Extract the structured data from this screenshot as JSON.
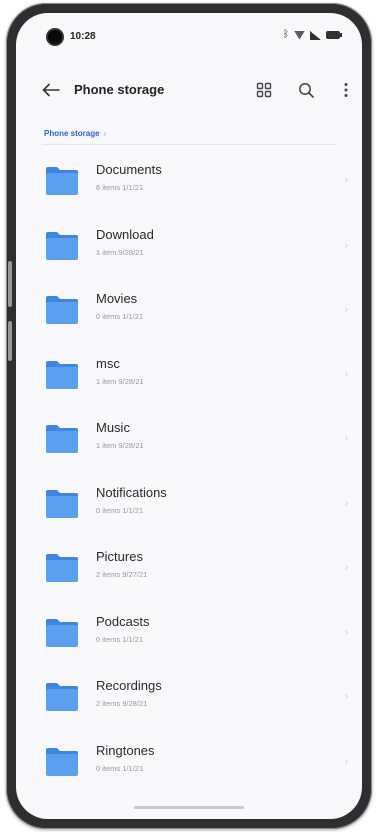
{
  "status_bar": {
    "time": "10:28"
  },
  "app_bar": {
    "title": "Phone storage"
  },
  "breadcrumb": {
    "items": [
      "Phone storage"
    ],
    "separator": "›"
  },
  "files": [
    {
      "name": "Documents",
      "meta": "6 items   1/1/21"
    },
    {
      "name": "Download",
      "meta": "1 item   9/28/21"
    },
    {
      "name": "Movies",
      "meta": "0 items   1/1/21"
    },
    {
      "name": "msc",
      "meta": "1 item   9/28/21"
    },
    {
      "name": "Music",
      "meta": "1 item   9/28/21"
    },
    {
      "name": "Notifications",
      "meta": "0 items   1/1/21"
    },
    {
      "name": "Pictures",
      "meta": "2 items   9/27/21"
    },
    {
      "name": "Podcasts",
      "meta": "0 items   1/1/21"
    },
    {
      "name": "Recordings",
      "meta": "2 items   9/28/21"
    },
    {
      "name": "Ringtones",
      "meta": "0 items   1/1/21"
    }
  ],
  "icons": {
    "back": "arrow-left-icon",
    "grid": "grid-view-icon",
    "search": "search-icon",
    "more": "more-vertical-icon",
    "folder": "folder-icon"
  },
  "colors": {
    "folder": "#5aa0ee",
    "folder_dark": "#3f86de",
    "accent": "#2e63c9",
    "background": "#f8f8fa"
  }
}
